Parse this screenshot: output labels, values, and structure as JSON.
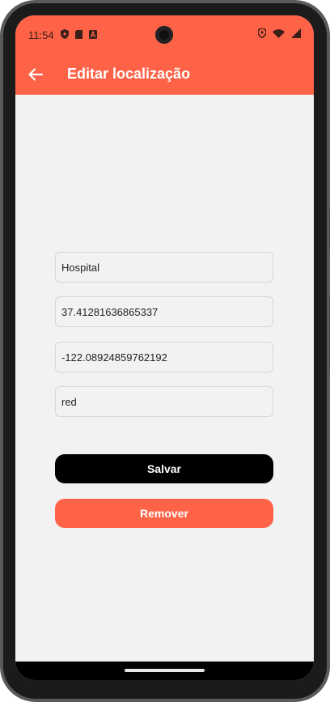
{
  "status_bar": {
    "time": "11:54"
  },
  "app_bar": {
    "title": "Editar localização",
    "back_icon": "arrow-left-icon"
  },
  "form": {
    "name_value": "Hospital",
    "latitude_value": "37.41281636865337",
    "longitude_value": "-122.08924859762192",
    "color_value": "red"
  },
  "actions": {
    "save_label": "Salvar",
    "remove_label": "Remover"
  },
  "colors": {
    "accent": "#ff6347",
    "primary_button": "#000000",
    "background": "#f2f2f2"
  }
}
